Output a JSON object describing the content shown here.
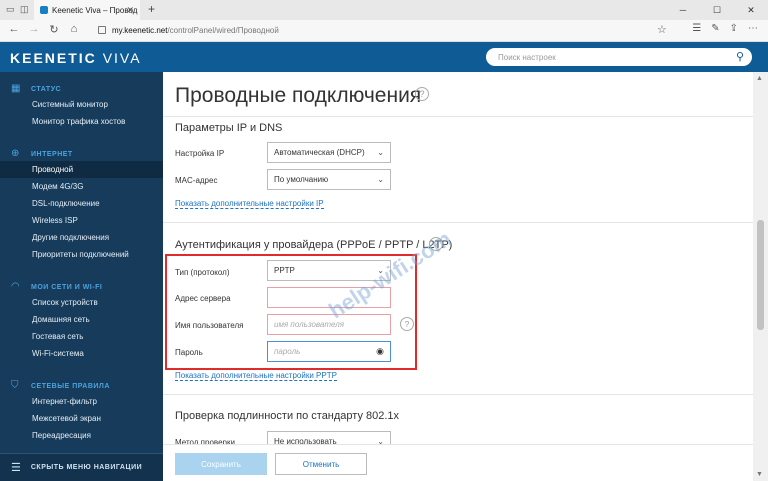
{
  "browser": {
    "tab_title": "Keenetic Viva – Провод",
    "url_domain": "my.keenetic.net",
    "url_path": "/controlPanel/wired/Проводной"
  },
  "header": {
    "logo": "KEENETIC",
    "logo_model": "VIVA",
    "search_placeholder": "Поиск настроек"
  },
  "sidebar": {
    "sections": [
      {
        "title": "СТАТУС",
        "items": [
          "Системный монитор",
          "Монитор трафика хостов"
        ]
      },
      {
        "title": "ИНТЕРНЕТ",
        "items": [
          "Проводной",
          "Модем 4G/3G",
          "DSL-подключение",
          "Wireless ISP",
          "Другие подключения",
          "Приоритеты подключений"
        ]
      },
      {
        "title": "МОИ СЕТИ И WI-FI",
        "items": [
          "Список устройств",
          "Домашняя сеть",
          "Гостевая сеть",
          "Wi-Fi-система"
        ]
      },
      {
        "title": "СЕТЕВЫЕ ПРАВИЛА",
        "items": [
          "Интернет-фильтр",
          "Межсетевой экран",
          "Переадресация"
        ]
      }
    ],
    "collapse_label": "СКРЫТЬ МЕНЮ НАВИГАЦИИ"
  },
  "main": {
    "page_title": "Проводные подключения",
    "ip_section": {
      "title": "Параметры IP и DNS",
      "ip_label": "Настройка IP",
      "ip_value": "Автоматическая (DHCP)",
      "mac_label": "MAC-адрес",
      "mac_value": "По умолчанию",
      "more_link": "Показать дополнительные настройки IP"
    },
    "auth_section": {
      "title": "Аутентификация у провайдера (PPPoE / PPTP / L2TP)",
      "type_label": "Тип (протокол)",
      "type_value": "PPTP",
      "server_label": "Адрес сервера",
      "server_value": "",
      "user_label": "Имя пользователя",
      "user_placeholder": "имя пользователя",
      "pass_label": "Пароль",
      "pass_placeholder": "пароль",
      "more_link": "Показать дополнительные настройки PPTP"
    },
    "dot1x_section": {
      "title": "Проверка подлинности по стандарту 802.1x",
      "method_label": "Метод проверки",
      "method_value": "Не использовать"
    },
    "save_button": "Сохранить",
    "cancel_button": "Отменить"
  },
  "watermark": "help-wifi.com"
}
